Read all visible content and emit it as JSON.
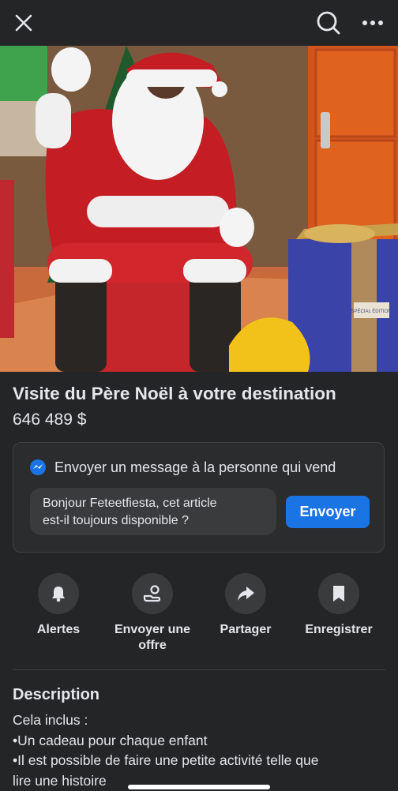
{
  "topbar": {
    "close_icon": "close-icon",
    "search_icon": "search-icon",
    "more_icon": "more-icon"
  },
  "listing": {
    "title": "Visite du Père Noël à votre destination",
    "price": "646 489 $",
    "gift_tag_text": "SPÉCIAL ÉDITION"
  },
  "message": {
    "header": "Envoyer un message à la personne qui vend",
    "line1": "Bonjour Feteetfiesta, cet article",
    "line2": "est-il toujours disponible ?",
    "send_label": "Envoyer"
  },
  "actions": [
    {
      "label": "Alertes",
      "icon": "bell-icon"
    },
    {
      "label": "Envoyer une",
      "label2": "offre",
      "icon": "offer-icon"
    },
    {
      "label": "Partager",
      "icon": "share-icon"
    },
    {
      "label": "Enregistrer",
      "icon": "bookmark-icon"
    }
  ],
  "description": {
    "title": "Description",
    "lines": [
      "Cela inclus :",
      "•Un cadeau pour chaque enfant",
      "•Il est possible de faire une petite activité telle que",
      "lire une histoire"
    ]
  },
  "colors": {
    "accent": "#1b74e4",
    "background": "#242526",
    "card": "#3a3b3c",
    "text": "#e4e6eb"
  }
}
